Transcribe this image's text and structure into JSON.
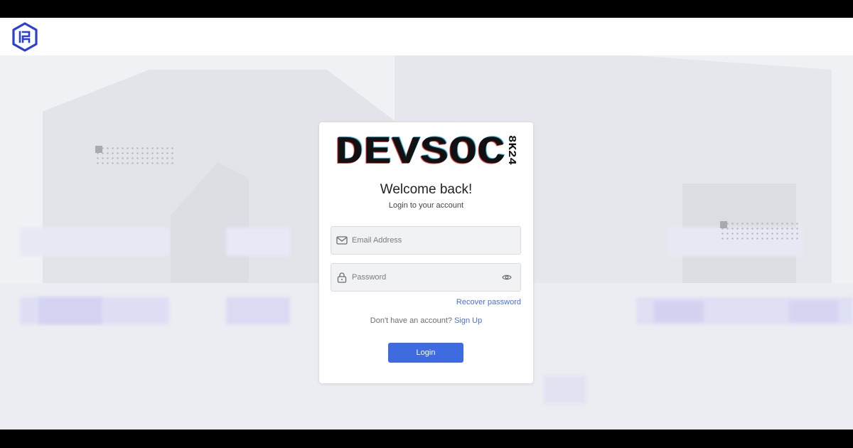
{
  "header": {
    "logo_icon": "devsoc-hex-logo-icon"
  },
  "brand": {
    "name": "DEVSOC",
    "tag": "8K24"
  },
  "card": {
    "welcome": "Welcome back!",
    "subtitle": "Login to your account"
  },
  "form": {
    "email_placeholder": "Email Address",
    "password_placeholder": "Password",
    "email_icon": "mail-icon",
    "password_icon": "lock-icon",
    "toggle_icon": "eye-icon",
    "recover_label": "Recover password",
    "no_account_text": "Don't have an account?",
    "signup_label": "Sign Up",
    "login_label": "Login"
  },
  "colors": {
    "accent": "#3f6be0",
    "link": "#4a6fd8",
    "logo": "#2b3fd6"
  }
}
